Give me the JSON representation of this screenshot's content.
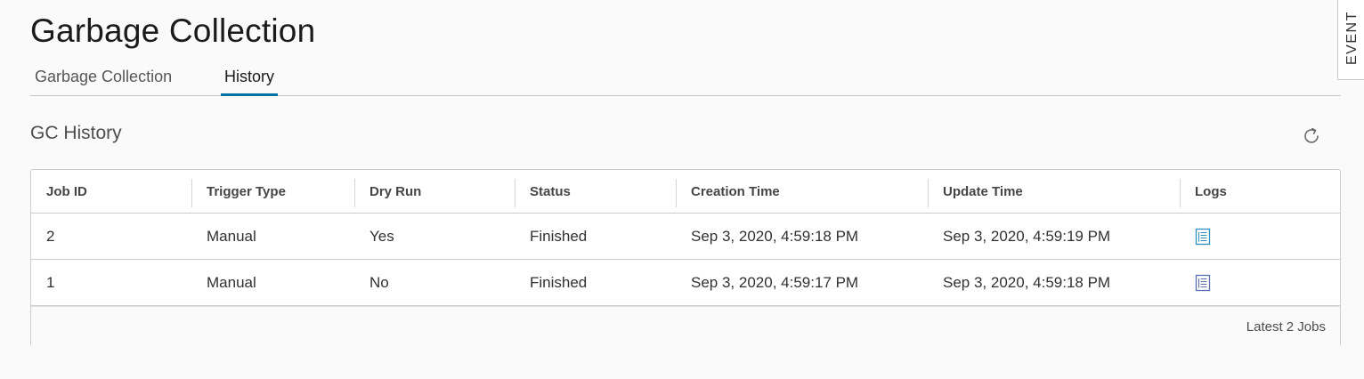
{
  "page": {
    "title": "Garbage Collection"
  },
  "tabs": [
    {
      "label": "Garbage Collection"
    },
    {
      "label": "History"
    }
  ],
  "active_tab": "History",
  "event_panel": {
    "label": "EVENT"
  },
  "section": {
    "title": "GC History"
  },
  "table": {
    "columns": [
      "Job ID",
      "Trigger Type",
      "Dry Run",
      "Status",
      "Creation Time",
      "Update Time",
      "Logs"
    ],
    "rows": [
      {
        "job_id": "2",
        "trigger_type": "Manual",
        "dry_run": "Yes",
        "status": "Finished",
        "creation_time": "Sep 3, 2020, 4:59:18 PM",
        "update_time": "Sep 3, 2020, 4:59:19 PM",
        "logs_icon": "log-document-icon"
      },
      {
        "job_id": "1",
        "trigger_type": "Manual",
        "dry_run": "No",
        "status": "Finished",
        "creation_time": "Sep 3, 2020, 4:59:17 PM",
        "update_time": "Sep 3, 2020, 4:59:18 PM",
        "logs_icon": "log-document-icon"
      }
    ],
    "footer": "Latest 2 Jobs"
  },
  "icons": {
    "refresh": "refresh-icon",
    "logs": "log-document-icon"
  },
  "colors": {
    "accent": "#0072a3",
    "log_icon": "#5b7fa6",
    "log_icon_active": "#2e8fc0"
  }
}
